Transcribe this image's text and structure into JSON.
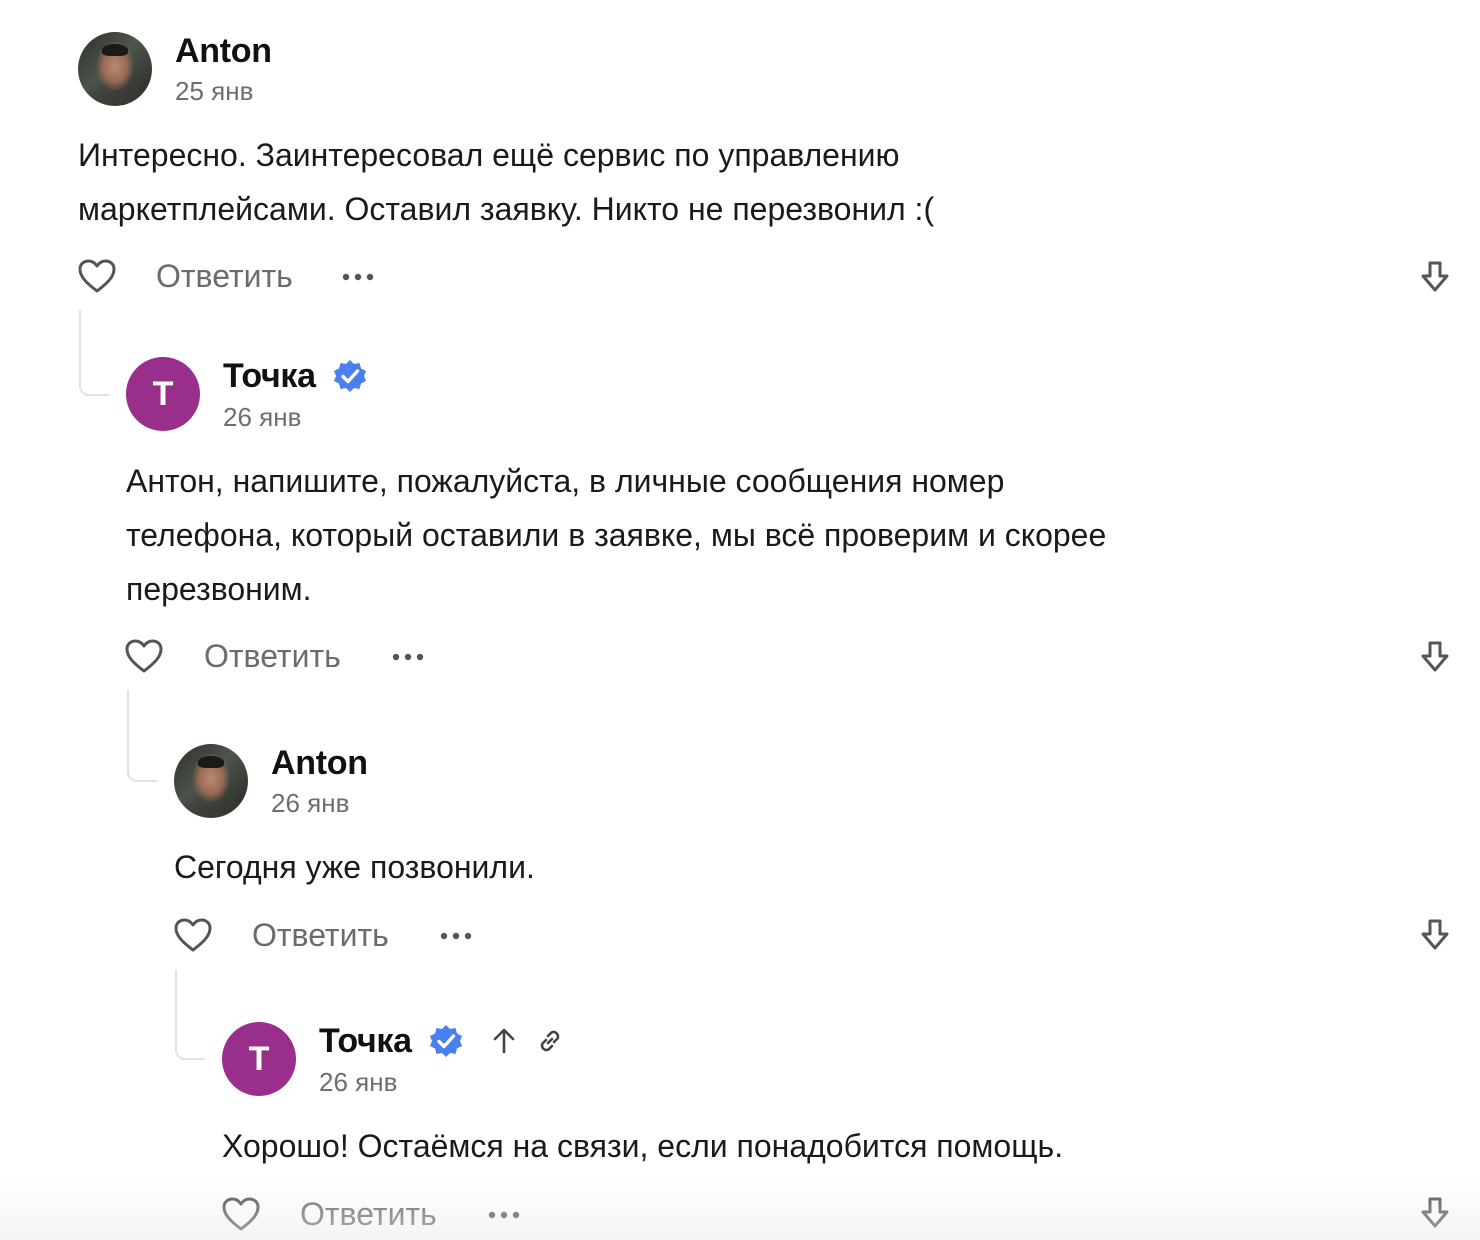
{
  "comments": [
    {
      "author": "Anton",
      "date": "25 янв",
      "avatar": {
        "kind": "photo"
      },
      "verified": false,
      "text_lines": [
        "Интересно. Заинтересовал ещё сервис по управлению",
        "маркетплейсами. Оставил заявку. Никто не перезвонил :("
      ],
      "reply_label": "Ответить"
    },
    {
      "author": "Точка",
      "date": "26 янв",
      "avatar": {
        "kind": "brand",
        "letter": "Т",
        "color": "#9a2e8b"
      },
      "verified": true,
      "text_lines": [
        "Антон, напишите, пожалуйста, в личные сообщения номер",
        "телефона, который оставили в заявке, мы всё проверим и скорее",
        "перезвоним."
      ],
      "reply_label": "Ответить"
    },
    {
      "author": "Anton",
      "date": "26 янв",
      "avatar": {
        "kind": "photo"
      },
      "verified": false,
      "text_lines": [
        "Сегодня уже позвонили."
      ],
      "reply_label": "Ответить"
    },
    {
      "author": "Точка",
      "date": "26 янв",
      "avatar": {
        "kind": "brand",
        "letter": "Т",
        "color": "#9a2e8b"
      },
      "verified": true,
      "meta_icons": [
        "arrow-up-icon",
        "link-icon"
      ],
      "text_lines": [
        "Хорошо! Остаёмся на связи, если понадобится помощь."
      ],
      "reply_label": "Ответить"
    }
  ],
  "colors": {
    "verified": "#4a7ff0",
    "brand": "#9a2e8b",
    "muted": "#6b6b6b"
  },
  "icons": {
    "like": "heart-outline-icon",
    "more": "more-dots-icon",
    "collapse": "arrow-down-icon",
    "verified": "verified-badge-icon"
  }
}
